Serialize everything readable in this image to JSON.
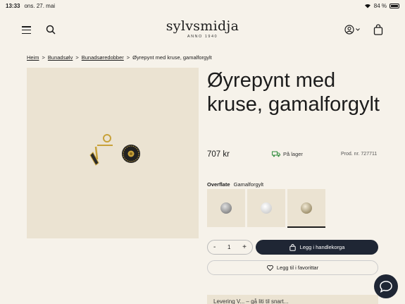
{
  "status_bar": {
    "time": "13:33",
    "date": "ons. 27. mai",
    "battery": "84 %"
  },
  "header": {
    "brand": "sylvsmidja",
    "brand_sub": "ANNO 1940"
  },
  "breadcrumb": {
    "items": [
      "Heim",
      "Bunadsølv",
      "Bunadsøredobber"
    ],
    "current": "Øyrepynt med kruse, gamalforgylt",
    "separator": ">"
  },
  "product": {
    "title": "Øyrepynt med kruse, gamalforgylt",
    "price": "707 kr",
    "stock": "På lager",
    "product_number": "Prod. nr. 727711",
    "surface_label": "Overflate",
    "surface_value": "Gamalforgylt",
    "swatches": [
      {
        "name": "silver-oxidized",
        "color": "#9a9a9a"
      },
      {
        "name": "silver-white",
        "color": "#e8e8e8"
      },
      {
        "name": "gamalforgylt",
        "color": "#b5a98a",
        "selected": true
      }
    ],
    "quantity": "1",
    "qty_minus": "-",
    "qty_plus": "+",
    "add_to_cart": "Legg i handlekorga",
    "add_to_favourites": "Legg til i favorittar"
  },
  "promo": {
    "text": "Levering V... – gå liti til snart..."
  },
  "colors": {
    "background": "#f6f2ea",
    "image_bg": "#ebe3d2",
    "primary": "#1f2634",
    "stock_green": "#2e8b3a"
  }
}
